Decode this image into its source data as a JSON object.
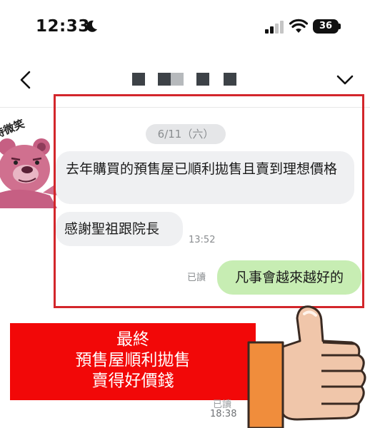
{
  "status_bar": {
    "time": "12:33",
    "battery": "36",
    "icons": [
      "moon-icon",
      "signal-icon",
      "wifi-icon",
      "battery-icon"
    ]
  },
  "nav": {
    "back_icon": "chevron-left-icon",
    "title": "",
    "menu_icon": "chevron-down-icon"
  },
  "chat": {
    "date": "6/11（六）",
    "messages": [
      {
        "from": "other",
        "text": "去年購買的預售屋已順利拋售且賣到理想價格"
      },
      {
        "from": "other",
        "text": "感謝聖祖跟院長",
        "time": "13:52"
      },
      {
        "from": "me",
        "text": "凡事會越來越好的",
        "read": "已讀"
      }
    ]
  },
  "sticker": {
    "text": "持微笑"
  },
  "banner": {
    "lines": [
      "最終",
      "預售屋順利拋售",
      "賣得好價錢"
    ]
  },
  "footer": {
    "time": "18:38"
  },
  "colors": {
    "highlight_border": "#d3262b",
    "banner_bg": "#f20808",
    "outgoing_bubble": "#c7edb3",
    "incoming_bubble": "#eff0f2"
  }
}
